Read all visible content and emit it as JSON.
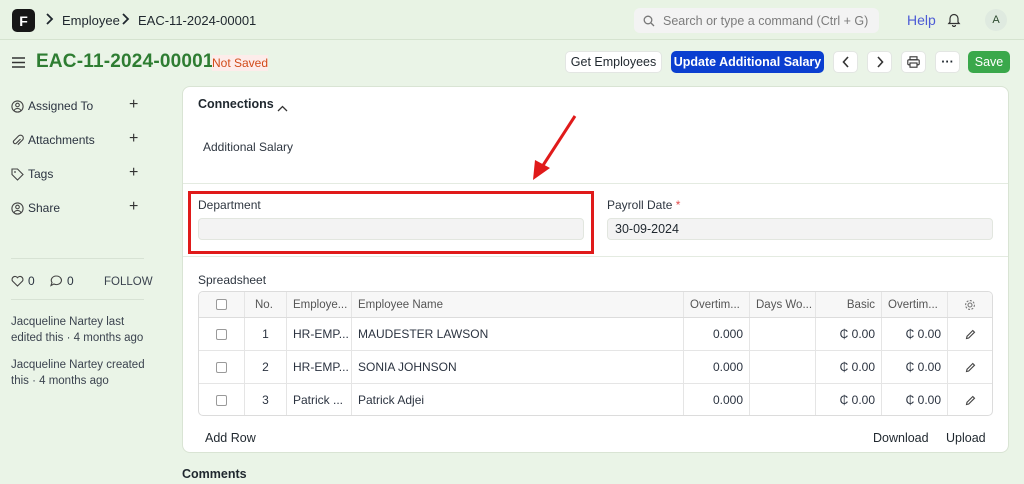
{
  "navbar": {
    "logo": "F",
    "breadcrumbs": [
      "Employee",
      "EAC-11-2024-00001"
    ],
    "search_placeholder": "Search or type a command (Ctrl + G)",
    "help": "Help",
    "avatar": "A"
  },
  "page": {
    "title": "EAC-11-2024-00001",
    "status": "Not Saved",
    "buttons": {
      "get_employees": "Get Employees",
      "update_salary": "Update Additional Salary",
      "more": "···",
      "save": "Save"
    }
  },
  "sidebar": {
    "items": [
      {
        "label": "Assigned To",
        "icon": "assign-icon"
      },
      {
        "label": "Attachments",
        "icon": "paperclip-icon"
      },
      {
        "label": "Tags",
        "icon": "tag-icon"
      },
      {
        "label": "Share",
        "icon": "share-icon"
      }
    ],
    "likes": "0",
    "comments": "0",
    "follow": "FOLLOW",
    "activity": [
      "Jacqueline Nartey last edited this · 4 months ago",
      "Jacqueline Nartey created this · 4 months ago"
    ]
  },
  "connections": {
    "title": "Connections",
    "link": "Additional Salary"
  },
  "form": {
    "department_label": "Department",
    "department_value": "",
    "payroll_date_label": "Payroll Date",
    "required_mark": "*",
    "payroll_date_value": "30-09-2024"
  },
  "spreadsheet": {
    "label": "Spreadsheet",
    "columns": [
      "No.",
      "Employe...",
      "Employee Name",
      "Overtim...",
      "Days Wo...",
      "Basic",
      "Overtim..."
    ],
    "rows": [
      {
        "no": "1",
        "employee": "HR-EMP...",
        "name": "MAUDESTER LAWSON",
        "overtime": "0.000",
        "days": "",
        "basic": "₵ 0.00",
        "overtime_amt": "₵ 0.00"
      },
      {
        "no": "2",
        "employee": "HR-EMP...",
        "name": "SONIA JOHNSON",
        "overtime": "0.000",
        "days": "",
        "basic": "₵ 0.00",
        "overtime_amt": "₵ 0.00"
      },
      {
        "no": "3",
        "employee": "Patrick ...",
        "name": "Patrick Adjei",
        "overtime": "0.000",
        "days": "",
        "basic": "₵ 0.00",
        "overtime_amt": "₵ 0.00"
      }
    ],
    "add_row": "Add Row",
    "download": "Download",
    "upload": "Upload"
  },
  "comments_title": "Comments",
  "colors": {
    "title_green": "#2e7d32",
    "primary_blue": "#0b3fd0",
    "save_green": "#3aa84b",
    "annotation_red": "#e01a1a"
  }
}
